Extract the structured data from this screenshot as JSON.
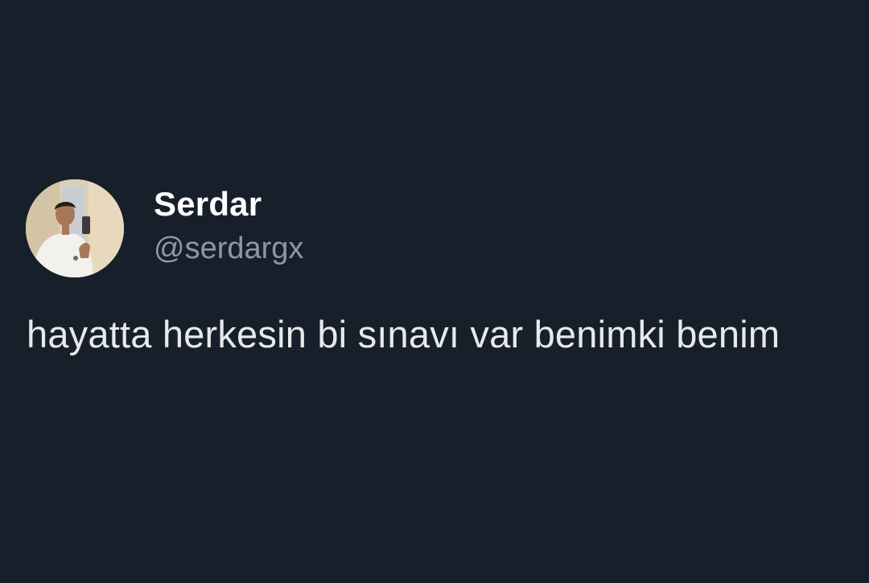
{
  "tweet": {
    "author": {
      "display_name": "Serdar",
      "handle": "@serdargx",
      "avatar_icon": "profile-photo"
    },
    "text": "hayatta herkesin bi sınavı var benimki benim"
  },
  "colors": {
    "background": "#17202a",
    "name": "#ffffff",
    "handle": "#8b98a5",
    "text": "#e7e9ea"
  }
}
